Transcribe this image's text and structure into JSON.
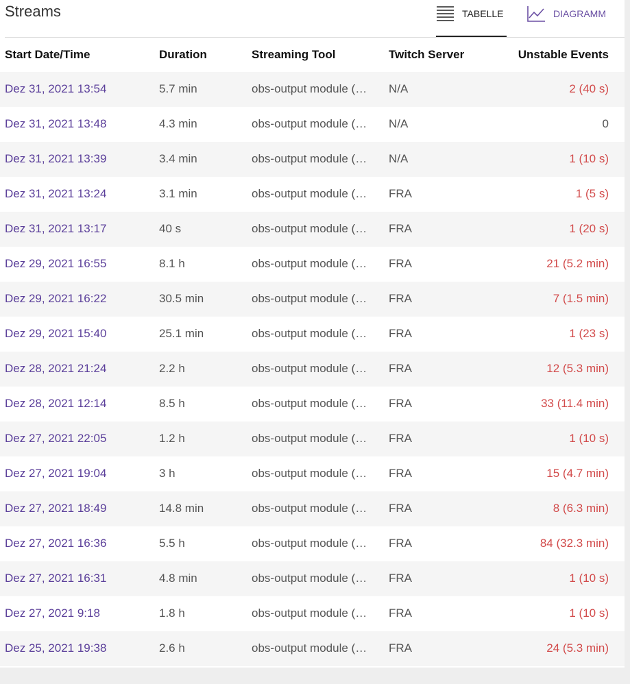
{
  "page": {
    "title": "Streams"
  },
  "tabs": {
    "table_label": "TABELLE",
    "chart_label": "DIAGRAMM",
    "active": "table"
  },
  "colors": {
    "accent": "#5b3f9a",
    "warning": "#d24b4b"
  },
  "table": {
    "headers": [
      "Start Date/Time",
      "Duration",
      "Streaming Tool",
      "Twitch Server",
      "Unstable Events"
    ],
    "rows": [
      {
        "start": "Dez 31, 2021 13:54",
        "duration": "5.7 min",
        "tool": "obs-output module (…",
        "server": "N/A",
        "events": "2 (40 s)"
      },
      {
        "start": "Dez 31, 2021 13:48",
        "duration": "4.3 min",
        "tool": "obs-output module (…",
        "server": "N/A",
        "events": "0"
      },
      {
        "start": "Dez 31, 2021 13:39",
        "duration": "3.4 min",
        "tool": "obs-output module (…",
        "server": "N/A",
        "events": "1 (10 s)"
      },
      {
        "start": "Dez 31, 2021 13:24",
        "duration": "3.1 min",
        "tool": "obs-output module (…",
        "server": "FRA",
        "events": "1 (5 s)"
      },
      {
        "start": "Dez 31, 2021 13:17",
        "duration": "40 s",
        "tool": "obs-output module (…",
        "server": "FRA",
        "events": "1 (20 s)"
      },
      {
        "start": "Dez 29, 2021 16:55",
        "duration": "8.1 h",
        "tool": "obs-output module (…",
        "server": "FRA",
        "events": "21 (5.2 min)"
      },
      {
        "start": "Dez 29, 2021 16:22",
        "duration": "30.5 min",
        "tool": "obs-output module (…",
        "server": "FRA",
        "events": "7 (1.5 min)"
      },
      {
        "start": "Dez 29, 2021 15:40",
        "duration": "25.1 min",
        "tool": "obs-output module (…",
        "server": "FRA",
        "events": "1 (23 s)"
      },
      {
        "start": "Dez 28, 2021 21:24",
        "duration": "2.2 h",
        "tool": "obs-output module (…",
        "server": "FRA",
        "events": "12 (5.3 min)"
      },
      {
        "start": "Dez 28, 2021 12:14",
        "duration": "8.5 h",
        "tool": "obs-output module (…",
        "server": "FRA",
        "events": "33 (11.4 min)"
      },
      {
        "start": "Dez 27, 2021 22:05",
        "duration": "1.2 h",
        "tool": "obs-output module (…",
        "server": "FRA",
        "events": "1 (10 s)"
      },
      {
        "start": "Dez 27, 2021 19:04",
        "duration": "3 h",
        "tool": "obs-output module (…",
        "server": "FRA",
        "events": "15 (4.7 min)"
      },
      {
        "start": "Dez 27, 2021 18:49",
        "duration": "14.8 min",
        "tool": "obs-output module (…",
        "server": "FRA",
        "events": "8 (6.3 min)"
      },
      {
        "start": "Dez 27, 2021 16:36",
        "duration": "5.5 h",
        "tool": "obs-output module (…",
        "server": "FRA",
        "events": "84 (32.3 min)"
      },
      {
        "start": "Dez 27, 2021 16:31",
        "duration": "4.8 min",
        "tool": "obs-output module (…",
        "server": "FRA",
        "events": "1 (10 s)"
      },
      {
        "start": "Dez 27, 2021 9:18",
        "duration": "1.8 h",
        "tool": "obs-output module (…",
        "server": "FRA",
        "events": "1 (10 s)"
      },
      {
        "start": "Dez 25, 2021 19:38",
        "duration": "2.6 h",
        "tool": "obs-output module (…",
        "server": "FRA",
        "events": "24 (5.3 min)"
      }
    ]
  }
}
